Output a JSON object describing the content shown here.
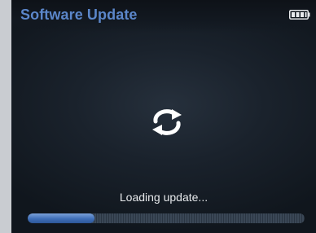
{
  "header": {
    "title": "Software Update",
    "battery_icon": "battery-full-icon"
  },
  "main": {
    "spinner_icon": "refresh-icon",
    "status_text": "Loading update..."
  },
  "progress": {
    "fraction": 0.24
  },
  "colors": {
    "title": "#5b86c9",
    "progress_fill": "#3f6fb8",
    "background": "#1a222c"
  }
}
